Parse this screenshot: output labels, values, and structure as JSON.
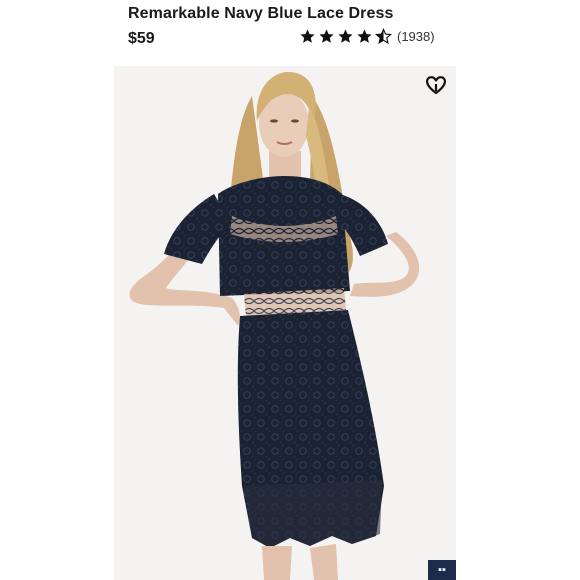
{
  "product": {
    "title": "Remarkable Navy Blue Lace Dress",
    "price": "$59",
    "rating": 4.5,
    "review_count": "(1938)"
  },
  "icons": {
    "rating_star": "star-icon",
    "favorite": "heart-icon",
    "corner_button": "grid-icon"
  },
  "colors": {
    "star": "#111111",
    "dress": "#1b2232",
    "corner_button": "#1c2b4a"
  }
}
